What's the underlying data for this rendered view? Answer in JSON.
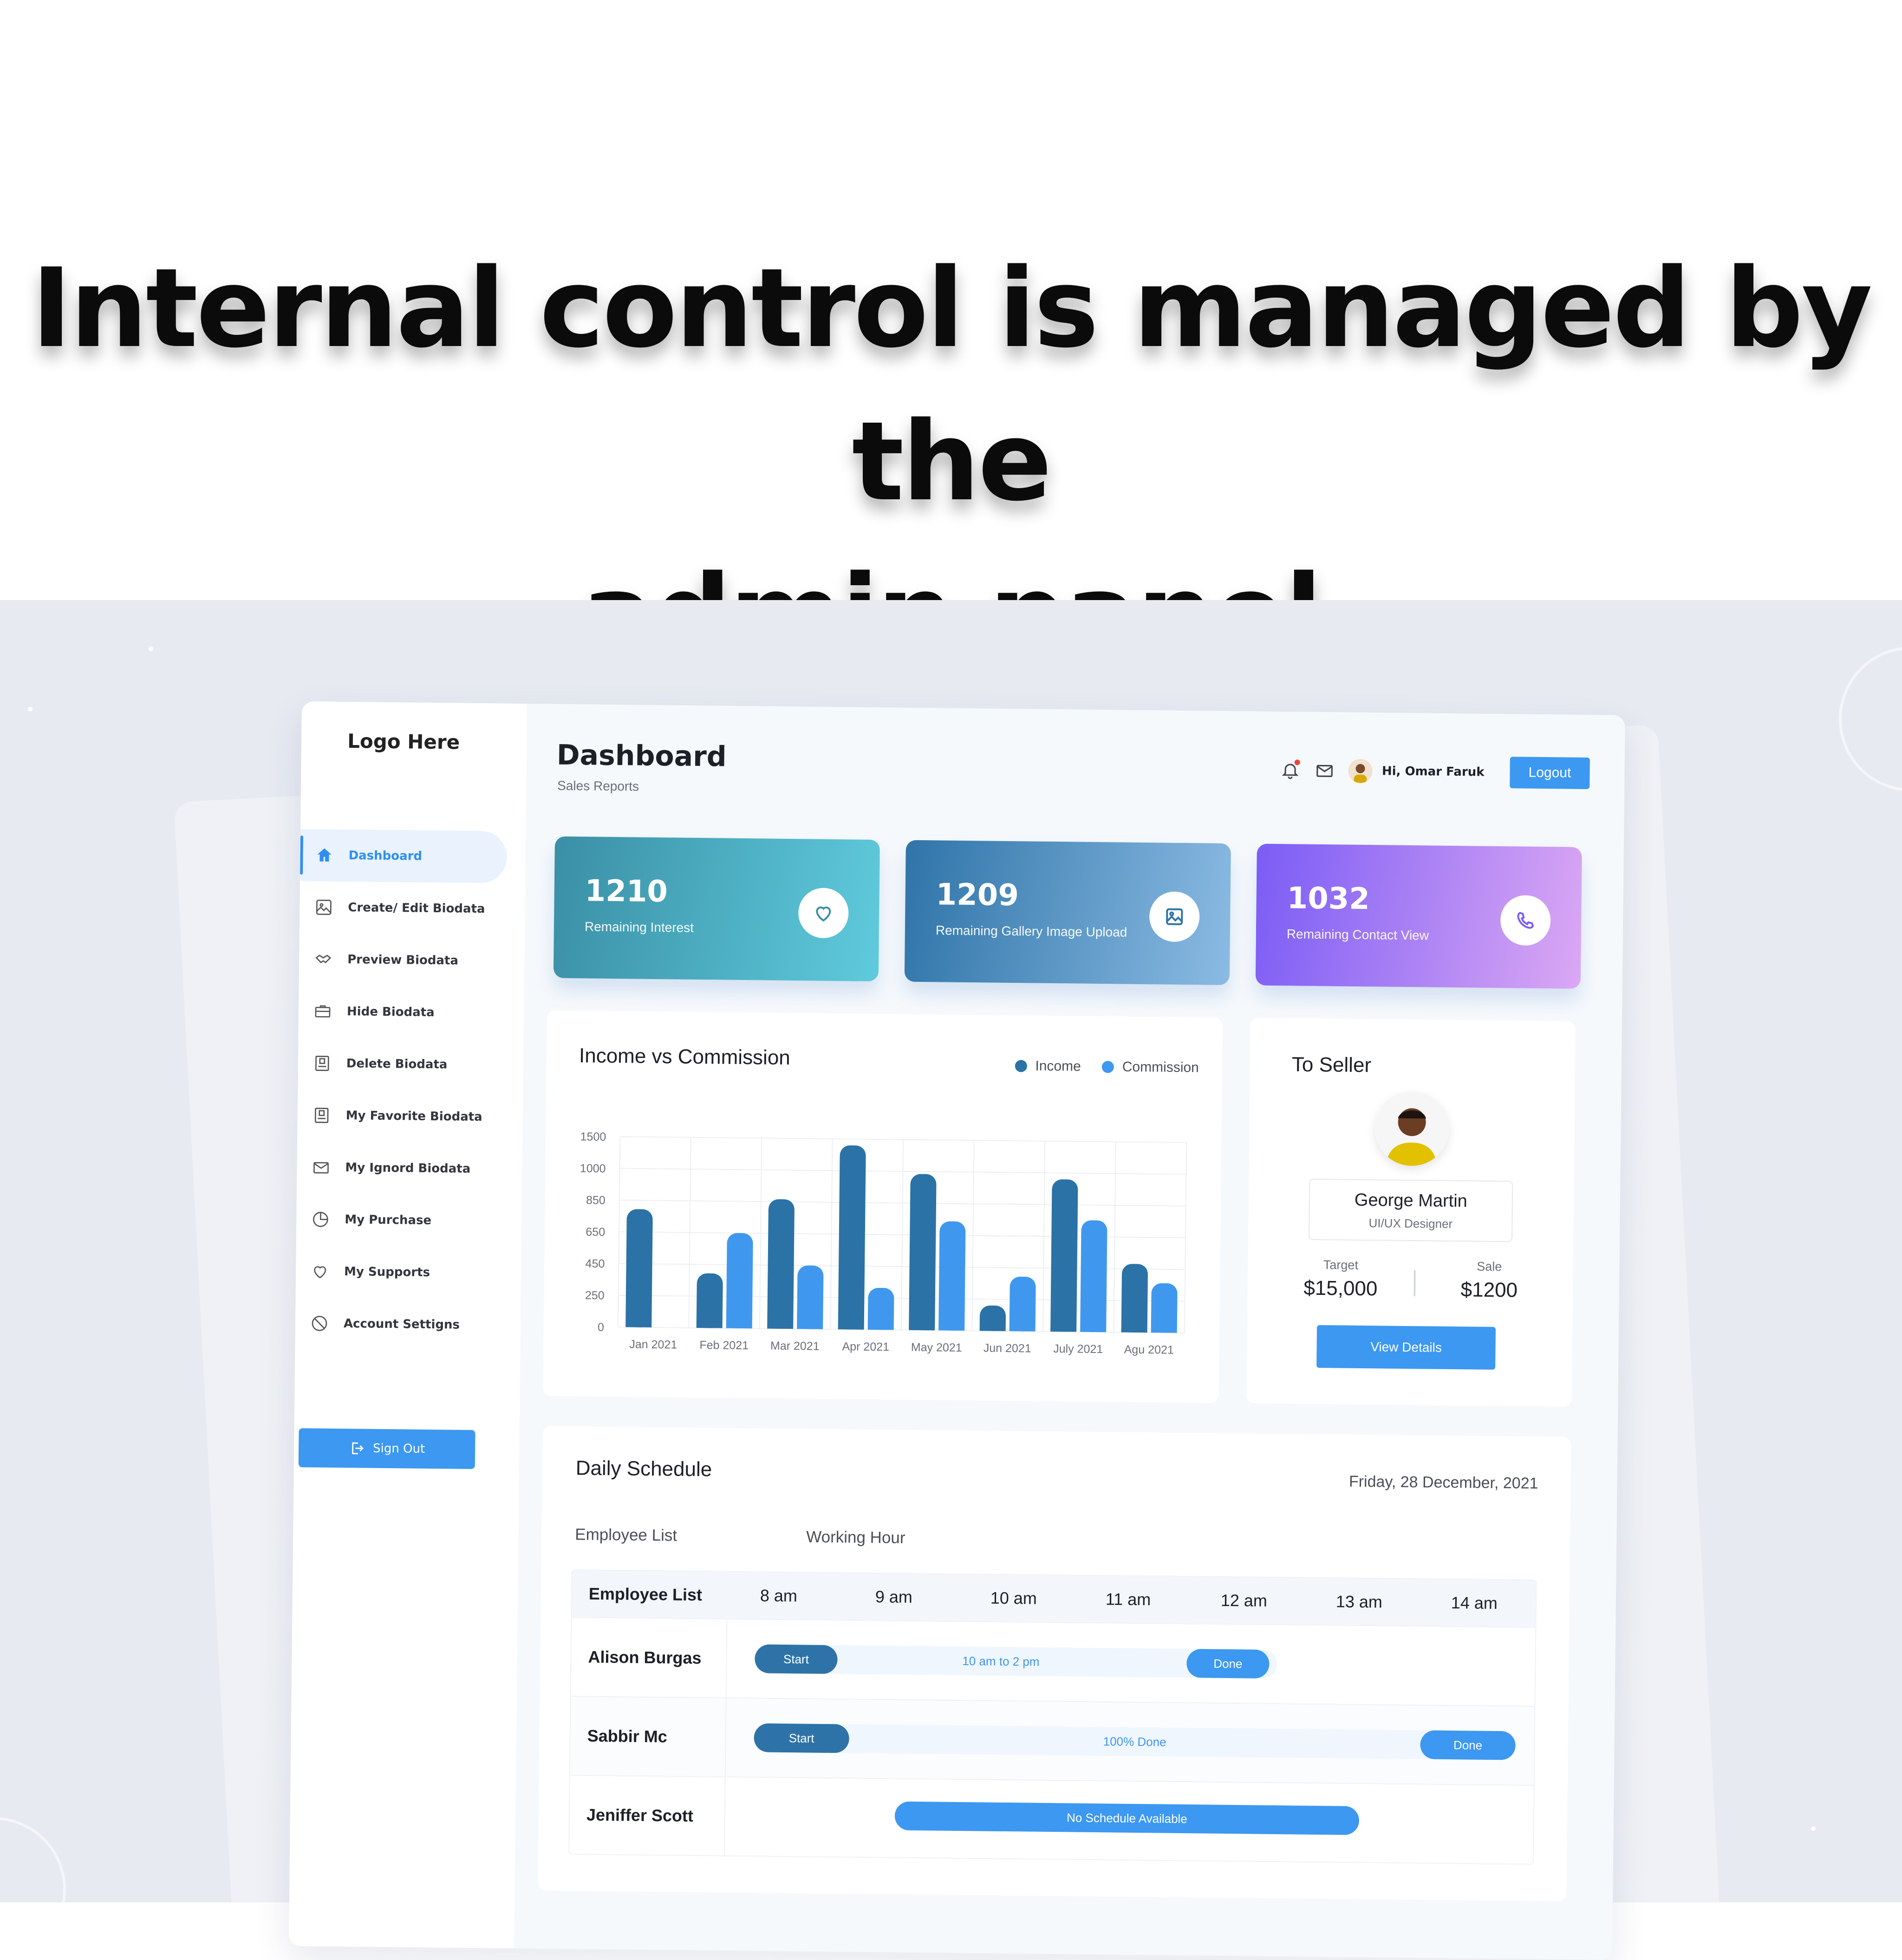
{
  "headline": {
    "line1": "Internal control is managed by the",
    "line2": "admin panel"
  },
  "sidebar": {
    "logo": "Logo Here",
    "items": [
      {
        "label": "Dashboard",
        "icon": "home-icon",
        "active": true
      },
      {
        "label": "Create/ Edit Biodata",
        "icon": "image-edit-icon"
      },
      {
        "label": "Preview Biodata",
        "icon": "handshake-icon"
      },
      {
        "label": "Hide Biodata",
        "icon": "briefcase-icon"
      },
      {
        "label": "Delete Biodata",
        "icon": "document-icon"
      },
      {
        "label": "My Favorite Biodata",
        "icon": "document-icon"
      },
      {
        "label": "My Ignord Biodata",
        "icon": "mail-icon"
      },
      {
        "label": "My Purchase",
        "icon": "pie-chart-icon"
      },
      {
        "label": "My Supports",
        "icon": "heart-icon"
      },
      {
        "label": "Account Settigns",
        "icon": "block-icon"
      }
    ],
    "sign_out": "Sign Out"
  },
  "header": {
    "title": "Dashboard",
    "subtitle": "Sales Reports",
    "greeting": "Hi, Omar Faruk",
    "logout": "Logout"
  },
  "stats": [
    {
      "value": "1210",
      "label": "Remaining Interest",
      "icon": "heart-icon"
    },
    {
      "value": "1209",
      "label": "Remaining Gallery Image Upload",
      "icon": "image-icon"
    },
    {
      "value": "1032",
      "label": "Remaining Contact View",
      "icon": "phone-icon"
    }
  ],
  "chart": {
    "title": "Income vs Commission",
    "legend": [
      "Income",
      "Commission"
    ]
  },
  "chart_data": {
    "type": "bar",
    "categories": [
      "Jan 2021",
      "Feb 2021",
      "Mar 2021",
      "Apr 2021",
      "May 2021",
      "Jun 2021",
      "July 2021",
      "Agu 2021"
    ],
    "series": [
      {
        "name": "Income",
        "values": [
          930,
          430,
          1020,
          1450,
          1230,
          200,
          1200,
          540
        ],
        "color": "#2b72a6"
      },
      {
        "name": "Commission",
        "values": [
          0,
          750,
          500,
          330,
          860,
          430,
          880,
          390
        ],
        "color": "#3f98ee"
      }
    ],
    "y_ticks": [
      "1500",
      "1000",
      "850",
      "650",
      "450",
      "250",
      "0"
    ],
    "ylim": [
      0,
      1500
    ],
    "grid": true,
    "legend_position": "top-right"
  },
  "seller": {
    "title": "To Seller",
    "name": "George Martin",
    "role": "UI/UX Designer",
    "target_label": "Target",
    "target_value": "$15,000",
    "sale_label": "Sale",
    "sale_value": "$1200",
    "button": "View Details"
  },
  "schedule": {
    "title": "Daily Schedule",
    "date": "Friday, 28 December, 2021",
    "sub_employee": "Employee List",
    "sub_hours": "Working Hour",
    "head_first": "Employee List",
    "hours": [
      "8 am",
      "9 am",
      "10 am",
      "11 am",
      "12 am",
      "13 am",
      "14 am"
    ],
    "rows": [
      {
        "name": "Alison Burgas",
        "start": "Start",
        "middle": "10 am to 2 pm",
        "end": "Done"
      },
      {
        "name": "Sabbir Mc",
        "start": "Start",
        "middle": "100% Done",
        "end": "Done"
      },
      {
        "name": "Jeniffer Scott",
        "middle": "No Schedule Available"
      }
    ]
  },
  "colors": {
    "accent": "#3c98f0",
    "stat1_from": "#3a8fa6",
    "stat1_to": "#5fcbdc",
    "stat2_from": "#2f74a8",
    "stat2_to": "#8bbbe3",
    "stat3_from": "#7b5cf5",
    "stat3_to": "#dba8f4"
  }
}
